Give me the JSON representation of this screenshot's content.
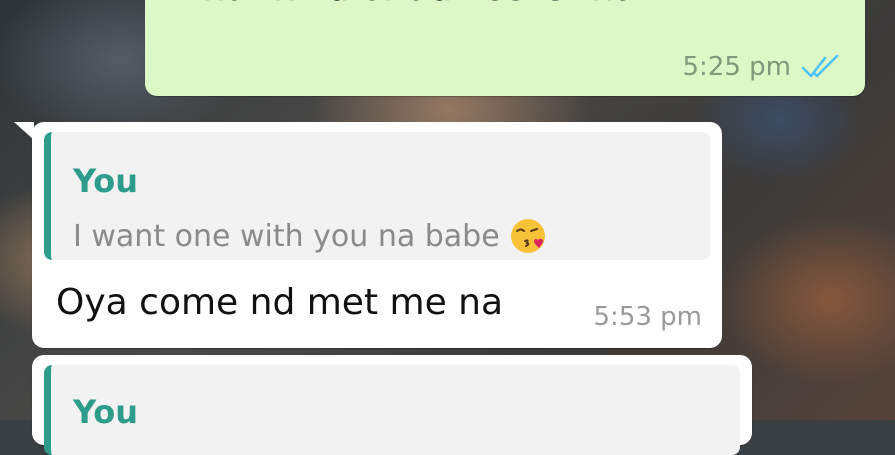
{
  "messages": {
    "outgoing": {
      "text": "What kind of advice is that!",
      "time": "5:25 pm",
      "status_icon": "double-check-icon",
      "status_color": "#4fc3f7"
    },
    "incoming_1": {
      "quote_author": "You",
      "quote_text": "I want one with you na babe",
      "quote_emoji": "kiss-emoji-icon",
      "text": "Oya come nd met me na",
      "time": "5:53 pm"
    },
    "incoming_2": {
      "quote_author": "You"
    }
  },
  "colors": {
    "outgoing_bubble": "#dcf8c6",
    "incoming_bubble": "#ffffff",
    "quote_accent": "#2e9c8a"
  }
}
